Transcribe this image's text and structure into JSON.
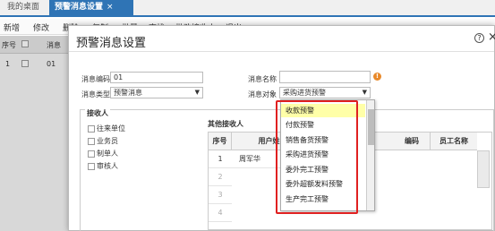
{
  "app_tabs": {
    "home": "我的桌面",
    "active": "预警消息设置",
    "close": "×"
  },
  "toolbar": {
    "items": [
      "新增",
      "修改",
      "删除",
      "复制",
      "批量",
      "查找",
      "批改接收人",
      "退出"
    ]
  },
  "bg_grid": {
    "col_seq": "序号",
    "col_msg": "消息",
    "row_seq": "1",
    "row_code": "01"
  },
  "modal": {
    "title": "预警消息设置",
    "help_icon": "?",
    "close_icon": "×",
    "msg_code_label": "消息编码",
    "msg_code_value": "01",
    "msg_name_label": "消息名称",
    "msg_name_value": "",
    "msg_type_label": "消息类型",
    "msg_type_value": "预警消息",
    "msg_target_label": "消息对象",
    "msg_target_value": "采购进货预警",
    "warn_icon": "!"
  },
  "receivers": {
    "title": "接收人",
    "options": [
      "往来单位",
      "业务员",
      "制单人",
      "审核人"
    ],
    "other_title": "其他接收人",
    "columns": [
      "序号",
      "用户姓名",
      "编码",
      "员工名称"
    ],
    "rows": [
      {
        "seq": "1",
        "name": "周军华"
      },
      {
        "seq": "2",
        "name": ""
      },
      {
        "seq": "3",
        "name": ""
      },
      {
        "seq": "4",
        "name": ""
      }
    ]
  },
  "dropdown": {
    "items": [
      "收款预警",
      "付款预警",
      "销售备货预警",
      "采购进货预警",
      "委外完工预警",
      "委外超额发料预警",
      "生产完工预警"
    ],
    "highlighted_index": 0,
    "highlight_color": "#ffffa8",
    "annotation_color": "#e02020"
  },
  "colors": {
    "accent": "#2f74b5",
    "warn": "#e8892a"
  }
}
